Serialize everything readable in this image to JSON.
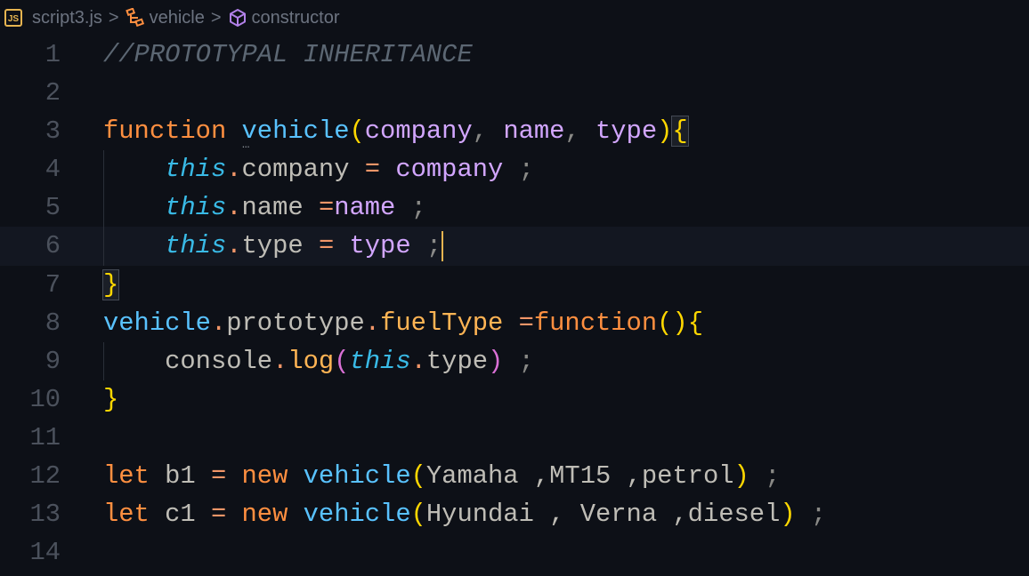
{
  "breadcrumb": {
    "file": "script3.js",
    "file_icon": "JS",
    "symbol1": "vehicle",
    "symbol2": "constructor",
    "separator": ">"
  },
  "current_line": 6,
  "lines": [
    {
      "n": "1",
      "t": [
        [
          "//PROTOTYPAL INHERITANCE",
          "cm"
        ]
      ]
    },
    {
      "n": "2",
      "t": []
    },
    {
      "n": "3",
      "t": [
        [
          "function",
          "kw"
        ],
        [
          " ",
          "tx"
        ],
        [
          "vehicle",
          "fn"
        ],
        [
          "(",
          "b1"
        ],
        [
          "company",
          "pa"
        ],
        [
          ", ",
          "pu"
        ],
        [
          "name",
          "pa"
        ],
        [
          ", ",
          "pu"
        ],
        [
          "type",
          "pa"
        ],
        [
          ")",
          "b1"
        ],
        [
          "{",
          "b1m"
        ]
      ]
    },
    {
      "n": "4",
      "t": [
        [
          "    ",
          "tx"
        ],
        [
          "this",
          "th"
        ],
        [
          ".",
          "op"
        ],
        [
          "company ",
          "tx"
        ],
        [
          "= ",
          "op"
        ],
        [
          "company",
          "pa"
        ],
        [
          " ;",
          "pu"
        ]
      ]
    },
    {
      "n": "5",
      "t": [
        [
          "    ",
          "tx"
        ],
        [
          "this",
          "th"
        ],
        [
          ".",
          "op"
        ],
        [
          "name ",
          "tx"
        ],
        [
          "=",
          "op"
        ],
        [
          "name",
          "pa"
        ],
        [
          " ;",
          "pu"
        ]
      ]
    },
    {
      "n": "6",
      "t": [
        [
          "    ",
          "tx"
        ],
        [
          "this",
          "th"
        ],
        [
          ".",
          "op"
        ],
        [
          "type ",
          "tx"
        ],
        [
          "= ",
          "op"
        ],
        [
          "type",
          "pa"
        ],
        [
          " ;",
          "pu"
        ]
      ]
    },
    {
      "n": "7",
      "t": [
        [
          "}",
          "b1m"
        ]
      ]
    },
    {
      "n": "8",
      "t": [
        [
          "vehicle",
          "fn"
        ],
        [
          ".",
          "op"
        ],
        [
          "prototype",
          "tx"
        ],
        [
          ".",
          "op"
        ],
        [
          "fuelType",
          "me"
        ],
        [
          " =",
          "op"
        ],
        [
          "function",
          "kw"
        ],
        [
          "()",
          "b1"
        ],
        [
          "{",
          "b1"
        ]
      ]
    },
    {
      "n": "9",
      "t": [
        [
          "    ",
          "tx"
        ],
        [
          "console",
          "tx"
        ],
        [
          ".",
          "op"
        ],
        [
          "log",
          "me"
        ],
        [
          "(",
          "b2"
        ],
        [
          "this",
          "th"
        ],
        [
          ".",
          "op"
        ],
        [
          "type",
          "tx"
        ],
        [
          ")",
          "b2"
        ],
        [
          " ;",
          "pu"
        ]
      ]
    },
    {
      "n": "10",
      "t": [
        [
          "}",
          "b1"
        ]
      ]
    },
    {
      "n": "11",
      "t": []
    },
    {
      "n": "12",
      "t": [
        [
          "let",
          "kw"
        ],
        [
          " b1 ",
          "tx"
        ],
        [
          "=",
          "op"
        ],
        [
          " ",
          "tx"
        ],
        [
          "new",
          "kw"
        ],
        [
          " ",
          "tx"
        ],
        [
          "vehicle",
          "fn"
        ],
        [
          "(",
          "b1"
        ],
        [
          "Yamaha ,MT15 ,petrol",
          "tx"
        ],
        [
          ")",
          "b1"
        ],
        [
          " ;",
          "pu"
        ]
      ]
    },
    {
      "n": "13",
      "t": [
        [
          "let",
          "kw"
        ],
        [
          " c1 ",
          "tx"
        ],
        [
          "=",
          "op"
        ],
        [
          " ",
          "tx"
        ],
        [
          "new",
          "kw"
        ],
        [
          " ",
          "tx"
        ],
        [
          "vehicle",
          "fn"
        ],
        [
          "(",
          "b1"
        ],
        [
          "Hyundai , Verna ,diesel",
          "tx"
        ],
        [
          ")",
          "b1"
        ],
        [
          " ;",
          "pu"
        ]
      ]
    },
    {
      "n": "14",
      "t": []
    }
  ]
}
